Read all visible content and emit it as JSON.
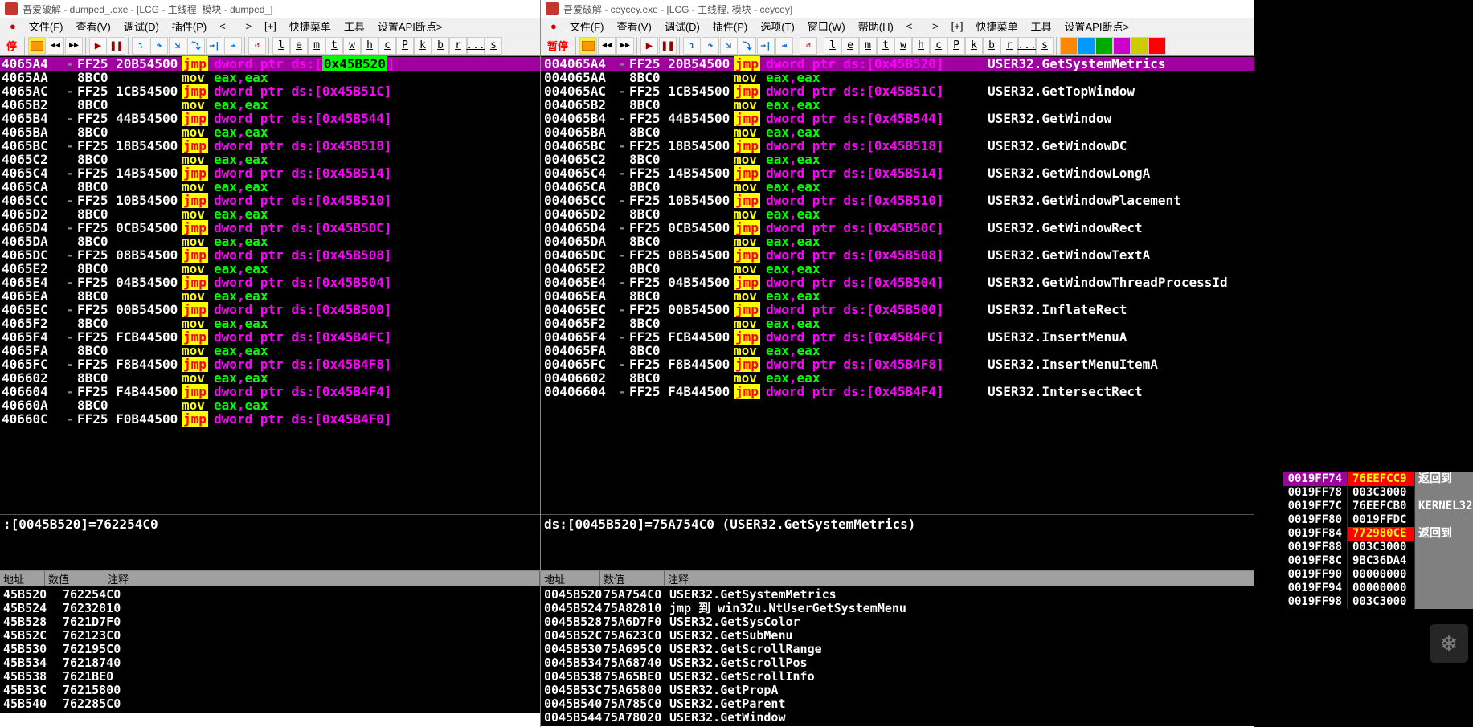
{
  "left": {
    "title": "吾爱破解 - dumped_.exe - [LCG - 主线程, 模块 - dumped_]",
    "menus": [
      "文件(F)",
      "查看(V)",
      "调试(D)",
      "插件(P)",
      "<-",
      "->",
      "[+]",
      "快捷菜单",
      "工具",
      "设置API断点>"
    ],
    "pause": "停",
    "letters": [
      "l",
      "e",
      "m",
      "t",
      "w",
      "h",
      "c",
      "P",
      "k",
      "b",
      "r",
      "...",
      "s"
    ],
    "disasm": [
      {
        "a": "4065A4",
        "d": "-",
        "b": "FF25 20B54500",
        "m": "jmp",
        "op": "dword ptr ds:[",
        "hi": "0x45B520",
        "tail": "]",
        "hl": 1
      },
      {
        "a": "4065AA",
        "d": "",
        "b": "8BC0",
        "m": "mov",
        "op": "eax,eax"
      },
      {
        "a": "4065AC",
        "d": "-",
        "b": "FF25 1CB54500",
        "m": "jmp",
        "op": "dword ptr ds:[0x45B51C]"
      },
      {
        "a": "4065B2",
        "d": "",
        "b": "8BC0",
        "m": "mov",
        "op": "eax,eax"
      },
      {
        "a": "4065B4",
        "d": "-",
        "b": "FF25 44B54500",
        "m": "jmp",
        "op": "dword ptr ds:[0x45B544]"
      },
      {
        "a": "4065BA",
        "d": "",
        "b": "8BC0",
        "m": "mov",
        "op": "eax,eax"
      },
      {
        "a": "4065BC",
        "d": "-",
        "b": "FF25 18B54500",
        "m": "jmp",
        "op": "dword ptr ds:[0x45B518]"
      },
      {
        "a": "4065C2",
        "d": "",
        "b": "8BC0",
        "m": "mov",
        "op": "eax,eax"
      },
      {
        "a": "4065C4",
        "d": "-",
        "b": "FF25 14B54500",
        "m": "jmp",
        "op": "dword ptr ds:[0x45B514]"
      },
      {
        "a": "4065CA",
        "d": "",
        "b": "8BC0",
        "m": "mov",
        "op": "eax,eax"
      },
      {
        "a": "4065CC",
        "d": "-",
        "b": "FF25 10B54500",
        "m": "jmp",
        "op": "dword ptr ds:[0x45B510]"
      },
      {
        "a": "4065D2",
        "d": "",
        "b": "8BC0",
        "m": "mov",
        "op": "eax,eax"
      },
      {
        "a": "4065D4",
        "d": "-",
        "b": "FF25 0CB54500",
        "m": "jmp",
        "op": "dword ptr ds:[0x45B50C]"
      },
      {
        "a": "4065DA",
        "d": "",
        "b": "8BC0",
        "m": "mov",
        "op": "eax,eax"
      },
      {
        "a": "4065DC",
        "d": "-",
        "b": "FF25 08B54500",
        "m": "jmp",
        "op": "dword ptr ds:[0x45B508]"
      },
      {
        "a": "4065E2",
        "d": "",
        "b": "8BC0",
        "m": "mov",
        "op": "eax,eax"
      },
      {
        "a": "4065E4",
        "d": "-",
        "b": "FF25 04B54500",
        "m": "jmp",
        "op": "dword ptr ds:[0x45B504]"
      },
      {
        "a": "4065EA",
        "d": "",
        "b": "8BC0",
        "m": "mov",
        "op": "eax,eax"
      },
      {
        "a": "4065EC",
        "d": "-",
        "b": "FF25 00B54500",
        "m": "jmp",
        "op": "dword ptr ds:[0x45B500]"
      },
      {
        "a": "4065F2",
        "d": "",
        "b": "8BC0",
        "m": "mov",
        "op": "eax,eax"
      },
      {
        "a": "4065F4",
        "d": "-",
        "b": "FF25 FCB44500",
        "m": "jmp",
        "op": "dword ptr ds:[0x45B4FC]"
      },
      {
        "a": "4065FA",
        "d": "",
        "b": "8BC0",
        "m": "mov",
        "op": "eax,eax"
      },
      {
        "a": "4065FC",
        "d": "-",
        "b": "FF25 F8B44500",
        "m": "jmp",
        "op": "dword ptr ds:[0x45B4F8]"
      },
      {
        "a": "406602",
        "d": "",
        "b": "8BC0",
        "m": "mov",
        "op": "eax,eax"
      },
      {
        "a": "406604",
        "d": "-",
        "b": "FF25 F4B44500",
        "m": "jmp",
        "op": "dword ptr ds:[0x45B4F4]"
      },
      {
        "a": "40660A",
        "d": "",
        "b": "8BC0",
        "m": "mov",
        "op": "eax,eax"
      },
      {
        "a": "40660C",
        "d": "-",
        "b": "FF25 F0B44500",
        "m": "jmp",
        "op": "dword ptr ds:[0x45B4F0]"
      }
    ],
    "info": ":[0045B520]=762254C0",
    "dump_hdr": [
      "地址",
      "数值",
      "注释"
    ],
    "dump": [
      [
        "45B520",
        "762254C0",
        ""
      ],
      [
        "45B524",
        "76232810",
        ""
      ],
      [
        "45B528",
        "7621D7F0",
        ""
      ],
      [
        "45B52C",
        "762123C0",
        ""
      ],
      [
        "45B530",
        "762195C0",
        ""
      ],
      [
        "45B534",
        "76218740",
        ""
      ],
      [
        "45B538",
        "7621BE0",
        ""
      ],
      [
        "45B53C",
        "76215800",
        ""
      ],
      [
        "45B540",
        "762285C0",
        ""
      ]
    ]
  },
  "right": {
    "title": "吾爱破解 - ceycey.exe - [LCG - 主线程, 模块 - ceycey]",
    "menus": [
      "文件(F)",
      "查看(V)",
      "调试(D)",
      "插件(P)",
      "<-",
      "->",
      "[+]",
      "快捷菜单",
      "工具",
      "设置API断点>"
    ],
    "pause": "暂停",
    "extra": [
      "选项(T)",
      "窗口(W)",
      "帮助(H)"
    ],
    "letters": [
      "l",
      "e",
      "m",
      "t",
      "w",
      "h",
      "c",
      "P",
      "k",
      "b",
      "r",
      "...",
      "s"
    ],
    "disasm": [
      {
        "a": "004065A4",
        "d": "-",
        "b": "FF25 20B54500",
        "m": "jmp",
        "op": "dword ptr ds:[0x45B520]",
        "c": "USER32.GetSystemMetrics",
        "hl": 1
      },
      {
        "a": "004065AA",
        "d": "",
        "b": "8BC0",
        "m": "mov",
        "op": "eax,eax",
        "c": ""
      },
      {
        "a": "004065AC",
        "d": "-",
        "b": "FF25 1CB54500",
        "m": "jmp",
        "op": "dword ptr ds:[0x45B51C]",
        "c": "USER32.GetTopWindow"
      },
      {
        "a": "004065B2",
        "d": "",
        "b": "8BC0",
        "m": "mov",
        "op": "eax,eax",
        "c": ""
      },
      {
        "a": "004065B4",
        "d": "-",
        "b": "FF25 44B54500",
        "m": "jmp",
        "op": "dword ptr ds:[0x45B544]",
        "c": "USER32.GetWindow"
      },
      {
        "a": "004065BA",
        "d": "",
        "b": "8BC0",
        "m": "mov",
        "op": "eax,eax",
        "c": ""
      },
      {
        "a": "004065BC",
        "d": "-",
        "b": "FF25 18B54500",
        "m": "jmp",
        "op": "dword ptr ds:[0x45B518]",
        "c": "USER32.GetWindowDC"
      },
      {
        "a": "004065C2",
        "d": "",
        "b": "8BC0",
        "m": "mov",
        "op": "eax,eax",
        "c": ""
      },
      {
        "a": "004065C4",
        "d": "-",
        "b": "FF25 14B54500",
        "m": "jmp",
        "op": "dword ptr ds:[0x45B514]",
        "c": "USER32.GetWindowLongA"
      },
      {
        "a": "004065CA",
        "d": "",
        "b": "8BC0",
        "m": "mov",
        "op": "eax,eax",
        "c": ""
      },
      {
        "a": "004065CC",
        "d": "-",
        "b": "FF25 10B54500",
        "m": "jmp",
        "op": "dword ptr ds:[0x45B510]",
        "c": "USER32.GetWindowPlacement"
      },
      {
        "a": "004065D2",
        "d": "",
        "b": "8BC0",
        "m": "mov",
        "op": "eax,eax",
        "c": ""
      },
      {
        "a": "004065D4",
        "d": "-",
        "b": "FF25 0CB54500",
        "m": "jmp",
        "op": "dword ptr ds:[0x45B50C]",
        "c": "USER32.GetWindowRect"
      },
      {
        "a": "004065DA",
        "d": "",
        "b": "8BC0",
        "m": "mov",
        "op": "eax,eax",
        "c": ""
      },
      {
        "a": "004065DC",
        "d": "-",
        "b": "FF25 08B54500",
        "m": "jmp",
        "op": "dword ptr ds:[0x45B508]",
        "c": "USER32.GetWindowTextA"
      },
      {
        "a": "004065E2",
        "d": "",
        "b": "8BC0",
        "m": "mov",
        "op": "eax,eax",
        "c": ""
      },
      {
        "a": "004065E4",
        "d": "-",
        "b": "FF25 04B54500",
        "m": "jmp",
        "op": "dword ptr ds:[0x45B504]",
        "c": "USER32.GetWindowThreadProcessId"
      },
      {
        "a": "004065EA",
        "d": "",
        "b": "8BC0",
        "m": "mov",
        "op": "eax,eax",
        "c": ""
      },
      {
        "a": "004065EC",
        "d": "-",
        "b": "FF25 00B54500",
        "m": "jmp",
        "op": "dword ptr ds:[0x45B500]",
        "c": "USER32.InflateRect"
      },
      {
        "a": "004065F2",
        "d": "",
        "b": "8BC0",
        "m": "mov",
        "op": "eax,eax",
        "c": ""
      },
      {
        "a": "004065F4",
        "d": "-",
        "b": "FF25 FCB44500",
        "m": "jmp",
        "op": "dword ptr ds:[0x45B4FC]",
        "c": "USER32.InsertMenuA"
      },
      {
        "a": "004065FA",
        "d": "",
        "b": "8BC0",
        "m": "mov",
        "op": "eax,eax",
        "c": ""
      },
      {
        "a": "004065FC",
        "d": "-",
        "b": "FF25 F8B44500",
        "m": "jmp",
        "op": "dword ptr ds:[0x45B4F8]",
        "c": "USER32.InsertMenuItemA"
      },
      {
        "a": "00406602",
        "d": "",
        "b": "8BC0",
        "m": "mov",
        "op": "eax,eax",
        "c": ""
      },
      {
        "a": "00406604",
        "d": "-",
        "b": "FF25 F4B44500",
        "m": "jmp",
        "op": "dword ptr ds:[0x45B4F4]",
        "c": "USER32.IntersectRect"
      }
    ],
    "info": "ds:[0045B520]=75A754C0 (USER32.GetSystemMetrics)",
    "dump_hdr": [
      "地址",
      "数值",
      "注释"
    ],
    "dump": [
      [
        "0045B520",
        "75A754C0",
        "USER32.GetSystemMetrics"
      ],
      [
        "0045B524",
        "75A82810",
        "jmp 到 win32u.NtUserGetSystemMenu"
      ],
      [
        "0045B528",
        "75A6D7F0",
        "USER32.GetSysColor"
      ],
      [
        "0045B52C",
        "75A623C0",
        "USER32.GetSubMenu"
      ],
      [
        "0045B530",
        "75A695C0",
        "USER32.GetScrollRange"
      ],
      [
        "0045B534",
        "75A68740",
        "USER32.GetScrollPos"
      ],
      [
        "0045B538",
        "75A65BE0",
        "USER32.GetScrollInfo"
      ],
      [
        "0045B53C",
        "75A65800",
        "USER32.GetPropA"
      ],
      [
        "0045B540",
        "75A785C0",
        "USER32.GetParent"
      ],
      [
        "0045B544",
        "75A78020",
        "USER32.GetWindow"
      ]
    ],
    "stack": [
      {
        "a": "0019FF74",
        "v": "76EEFCC9",
        "c": "返回到",
        "ret": 1,
        "hi": 1
      },
      {
        "a": "0019FF78",
        "v": "003C3000",
        "c": ""
      },
      {
        "a": "0019FF7C",
        "v": "76EEFCB0",
        "c": "KERNEL32"
      },
      {
        "a": "0019FF80",
        "v": "0019FFDC",
        "c": ""
      },
      {
        "a": "0019FF84",
        "v": "772980CE",
        "c": "返回到",
        "ret": 1
      },
      {
        "a": "0019FF88",
        "v": "003C3000",
        "c": ""
      },
      {
        "a": "0019FF8C",
        "v": "9BC36DA4",
        "c": ""
      },
      {
        "a": "0019FF90",
        "v": "00000000",
        "c": ""
      },
      {
        "a": "0019FF94",
        "v": "00000000",
        "c": ""
      },
      {
        "a": "0019FF98",
        "v": "003C3000",
        "c": ""
      }
    ]
  }
}
